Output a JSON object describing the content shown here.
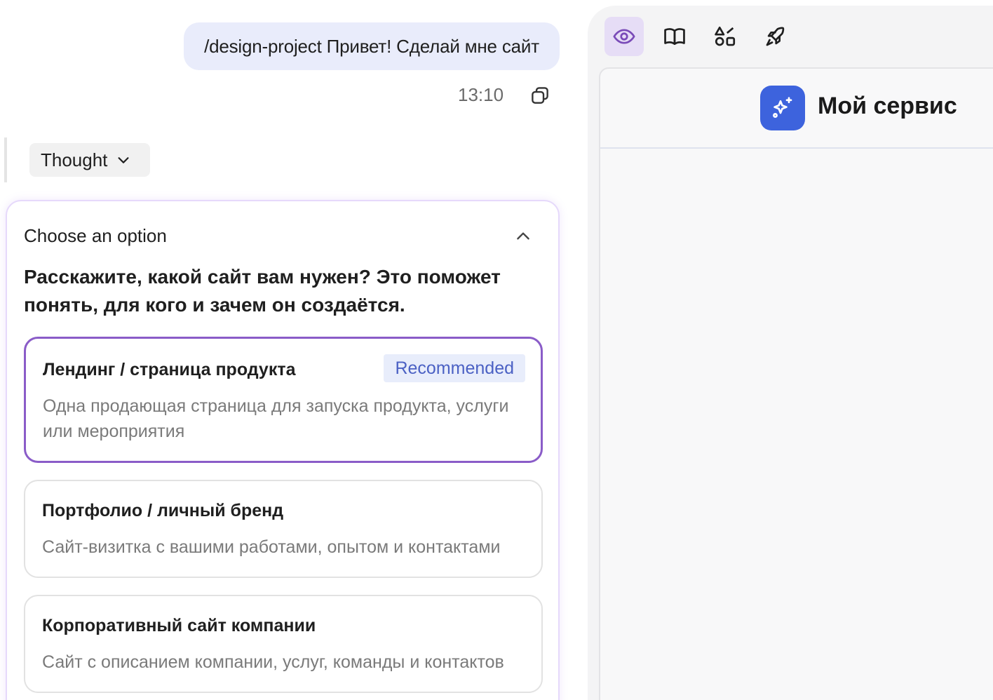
{
  "chat": {
    "user_message": "/design-project Привет! Сделай мне сайт",
    "time": "13:10",
    "thought_label": "Thought"
  },
  "option_card": {
    "header": "Choose an option",
    "question": "Расскажите, какой сайт вам нужен? Это поможет понять, для кого и зачем он создаётся.",
    "options": [
      {
        "title": "Лендинг / страница продукта",
        "description": "Одна продающая страница для запуска продукта, услуги или мероприятия",
        "badge": "Recommended",
        "selected": true
      },
      {
        "title": "Портфолио / личный бренд",
        "description": "Сайт-визитка с вашими работами, опытом и контактами",
        "selected": false
      },
      {
        "title": "Корпоративный сайт компании",
        "description": "Сайт с описанием компании, услуг, команды и контактов",
        "selected": false
      }
    ]
  },
  "preview": {
    "toolbar": [
      {
        "icon": "eye-icon",
        "active": true
      },
      {
        "icon": "book-icon",
        "active": false
      },
      {
        "icon": "shapes-icon",
        "active": false
      },
      {
        "icon": "rocket-icon",
        "active": false
      }
    ],
    "site_name": "Мой сервис",
    "logo_icon": "sparkle-icon"
  },
  "colors": {
    "accent_purple": "#8a5cc8",
    "brand_blue": "#3d63dd",
    "badge_text": "#4b61c4",
    "user_bubble": "#e9ecfb"
  }
}
